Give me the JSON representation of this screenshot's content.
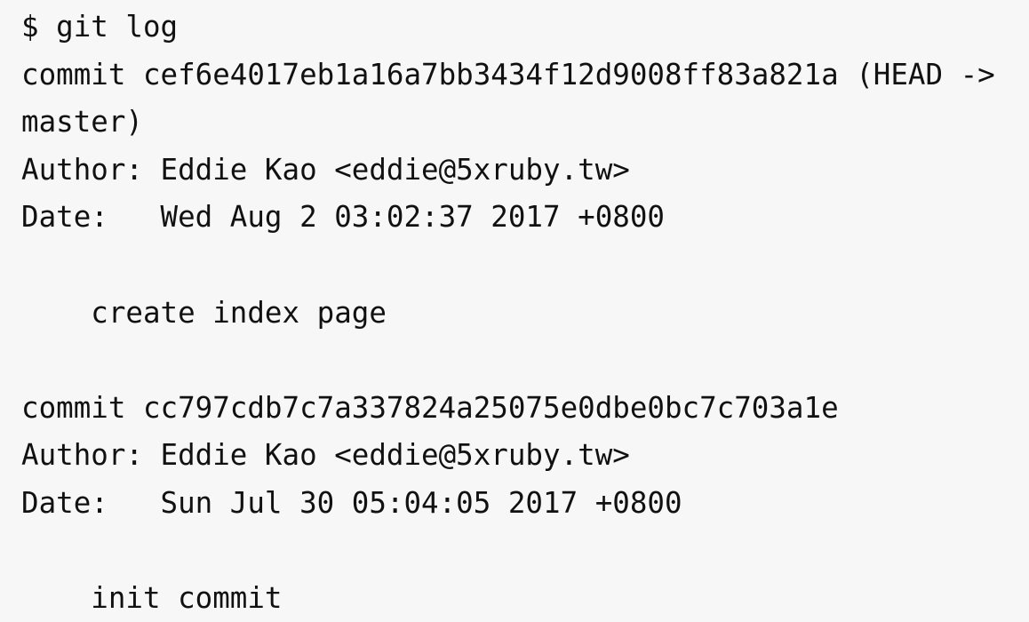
{
  "terminal": {
    "background": "#f7f7f7",
    "foreground": "#111111",
    "lines": [
      "$ git log",
      "commit cef6e4017eb1a16a7bb3434f12d9008ff83a821a (HEAD ->",
      "master)",
      "Author: Eddie Kao <eddie@5xruby.tw>",
      "Date:   Wed Aug 2 03:02:37 2017 +0800",
      "",
      "    create index page",
      "",
      "commit cc797cdb7c7a337824a25075e0dbe0bc7c703a1e",
      "Author: Eddie Kao <eddie@5xruby.tw>",
      "Date:   Sun Jul 30 05:04:05 2017 +0800",
      "",
      "    init commit"
    ]
  }
}
